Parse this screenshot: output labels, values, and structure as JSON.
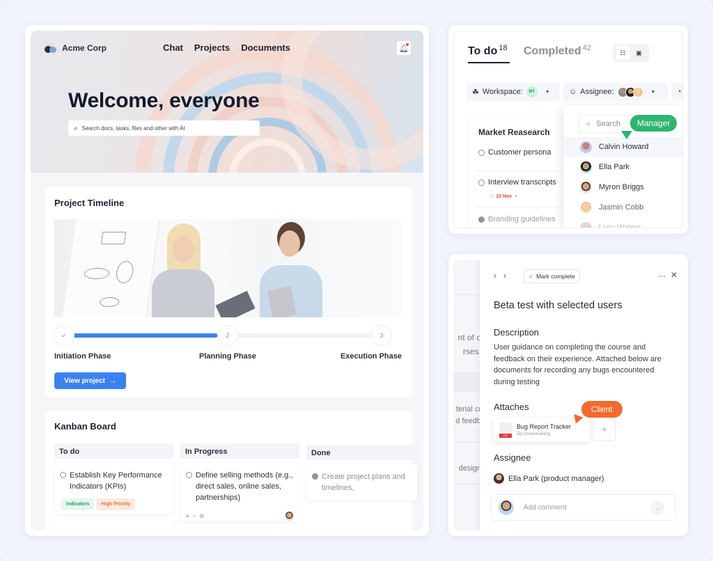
{
  "header": {
    "brand": "Acme Corp",
    "nav": [
      "Chat",
      "Projects",
      "Documents"
    ],
    "bell_icon": "bell-icon",
    "welcome": "Welcome, everyone",
    "search_placeholder": "Search docs, tasks, files and other with AI"
  },
  "timeline": {
    "title": "Project Timeline",
    "progress_fraction": 0.5,
    "steps": [
      {
        "marker": "✓",
        "label": "Initiation Phase",
        "state": "done"
      },
      {
        "marker": "2",
        "label": "Planning Phase",
        "state": "current"
      },
      {
        "marker": "3",
        "label": "Execution Phase",
        "state": "upcoming"
      }
    ],
    "button": "View project",
    "accent": "#3b82f0"
  },
  "kanban": {
    "title": "Kanban Board",
    "columns": [
      {
        "title": "To do",
        "card": {
          "text": "Establish Key Performance Indicators (KPIs)",
          "tags": [
            {
              "label": "Indicators",
              "bg": "#e4f7ee",
              "fg": "#2a9a63"
            },
            {
              "label": "High Priority",
              "bg": "#fde9df",
              "fg": "#e2743c"
            }
          ]
        }
      },
      {
        "title": "In Progress",
        "card": {
          "text": "Define selling methods (e.g., direct sales, online sales, partnerships)"
        }
      },
      {
        "title": "Done",
        "card": {
          "text": "Create project plans and timelines,"
        }
      }
    ]
  },
  "todo": {
    "tabs": [
      {
        "label": "To do",
        "count": "18"
      },
      {
        "label": "Completed",
        "count": "42"
      }
    ],
    "filters": {
      "workspace_label": "Workspace:",
      "workspace_badge": "MT",
      "assignee_label": "Assignee:"
    },
    "group": {
      "title": "Market Reasearch",
      "items": [
        {
          "text": "Customer persona",
          "done": false
        },
        {
          "text": "Interview transcripts",
          "done": false,
          "due": "10 Nov"
        },
        {
          "text": "Branding guidelines",
          "done": true
        }
      ]
    },
    "dropdown": {
      "search_placeholder": "Search",
      "people": [
        "Calvin Howard",
        "Ella Park",
        "Myron Briggs",
        "Jasmin Cobb",
        "Lucy Waters"
      ]
    },
    "manager_badge": "Manager",
    "manager_color": "#2fb56f"
  },
  "detail": {
    "mark_complete": "Mark complete",
    "title": "Beta test with selected users",
    "description_heading": "Description",
    "description": "User guidance on completing the course and feedback on their experience. Attached below are documents for recording any bugs encountered during testing",
    "attaches_heading": "Attaches",
    "attachment": {
      "name": "Bug Report Tracker",
      "status": "Zip.Downloading",
      "type": "ZIP"
    },
    "assignee_heading": "Assignee",
    "assignee": "Ella Park (product manager)",
    "comment_placeholder": "Add comment",
    "client_badge": "Client",
    "client_color": "#f26a2e",
    "behind_text": [
      "nt of o",
      "rses.",
      "terial cr",
      "d feedb",
      "design"
    ]
  }
}
